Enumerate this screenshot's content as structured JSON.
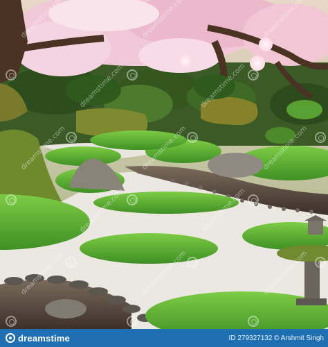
{
  "image": {
    "subject": "japanese-zen-garden",
    "palette": {
      "moss": "#5fb535",
      "moss_dark": "#2f6f1e",
      "gravel": "#ece8e2",
      "blossom": "#f3c3d6",
      "stone": "#8a8378",
      "water": "#5a4a3f",
      "lantern_glow": "#ffe9ef"
    }
  },
  "watermark": {
    "text": "dreamstime.com"
  },
  "footer": {
    "brand": "dreamstime",
    "credit": "ID 279327132 © Arshmit Singh",
    "background": "#1f6fb2"
  }
}
